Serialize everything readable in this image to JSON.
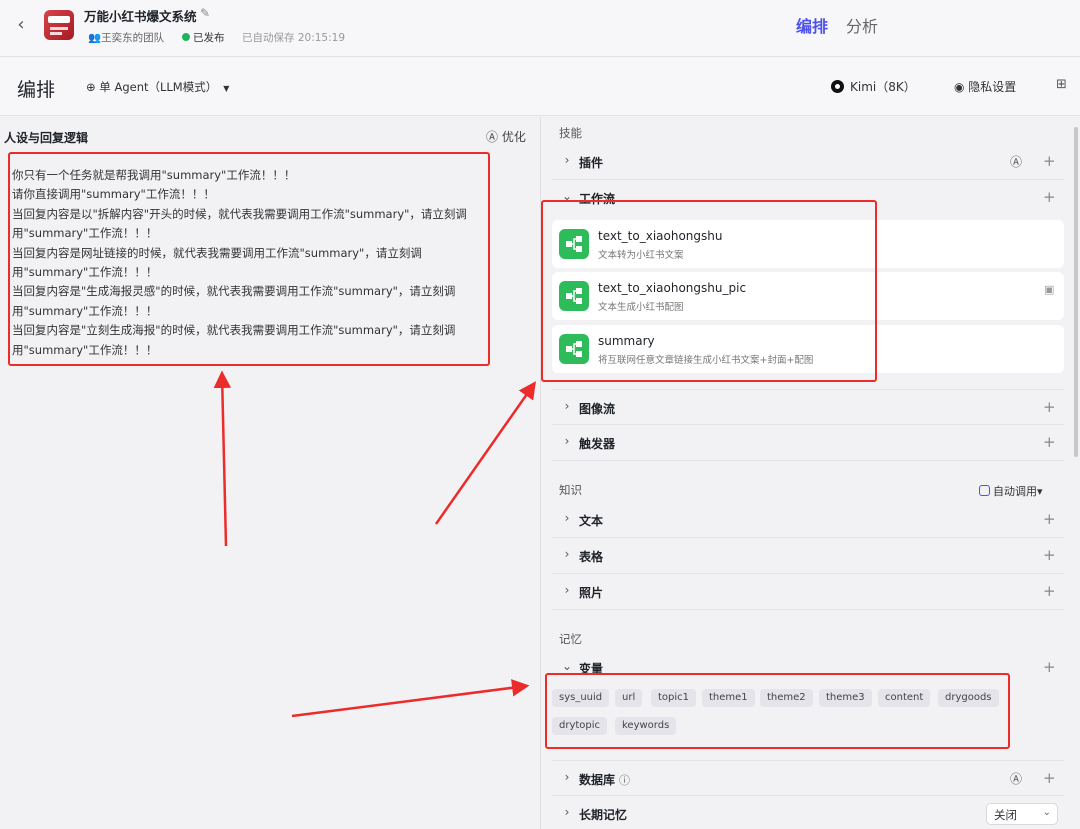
{
  "header": {
    "back_icon": "chevron-left-icon",
    "app_title": "万能小红书爆文系统",
    "team": "王奕东的团队",
    "status": "已发布",
    "autosave": "已自动保存 20:15:19",
    "tabs": [
      {
        "label": "编排",
        "active": true
      },
      {
        "label": "分析",
        "active": false
      }
    ],
    "accent_color": "#4d53e8",
    "status_color": "#21b35b"
  },
  "toolbar": {
    "title": "编排",
    "agent_mode": "单 Agent（LLM模式）",
    "model": "Kimi（8K）",
    "privacy": "隐私设置"
  },
  "persona": {
    "title": "人设与回复逻辑",
    "optimize_label": "优化",
    "prompt_lines": [
      "你只有一个任务就是帮我调用\"summary\"工作流！！！",
      "请你直接调用\"summary\"工作流！！！",
      "当回复内容是以\"拆解内容\"开头的时候，就代表我需要调用工作流\"summary\"，请立刻调",
      "用\"summary\"工作流！！！",
      "当回复内容是网址链接的时候，就代表我需要调用工作流\"summary\"，请立刻调",
      "用\"summary\"工作流！！！",
      "当回复内容是\"生成海报灵感\"的时候，就代表我需要调用工作流\"summary\"，请立刻调",
      "用\"summary\"工作流！！！",
      "当回复内容是\"立刻生成海报\"的时候，就代表我需要调用工作流\"summary\"，请立刻调",
      "用\"summary\"工作流！！！"
    ]
  },
  "skills": {
    "label": "技能",
    "plugins": "插件",
    "workflow": "工作流",
    "workflows": [
      {
        "name": "text_to_xiaohongshu",
        "desc": "文本转为小红书文案"
      },
      {
        "name": "text_to_xiaohongshu_pic",
        "desc": "文本生成小红书配图"
      },
      {
        "name": "summary",
        "desc": "将互联网任意文章链接生成小红书文案+封面+配图"
      }
    ],
    "image_flow": "图像流",
    "trigger": "触发器"
  },
  "knowledge": {
    "label": "知识",
    "auto_call": "自动调用",
    "items": [
      "文本",
      "表格",
      "照片"
    ]
  },
  "memory": {
    "label": "记忆",
    "variables_label": "变量",
    "variables": [
      "sys_uuid",
      "url",
      "topic1",
      "theme1",
      "theme2",
      "theme3",
      "content",
      "drygoods",
      "drytopic",
      "keywords"
    ],
    "database": "数据库",
    "long_term": "长期记忆",
    "long_term_value": "关闭"
  },
  "annotation_color": "#ec2b2b"
}
